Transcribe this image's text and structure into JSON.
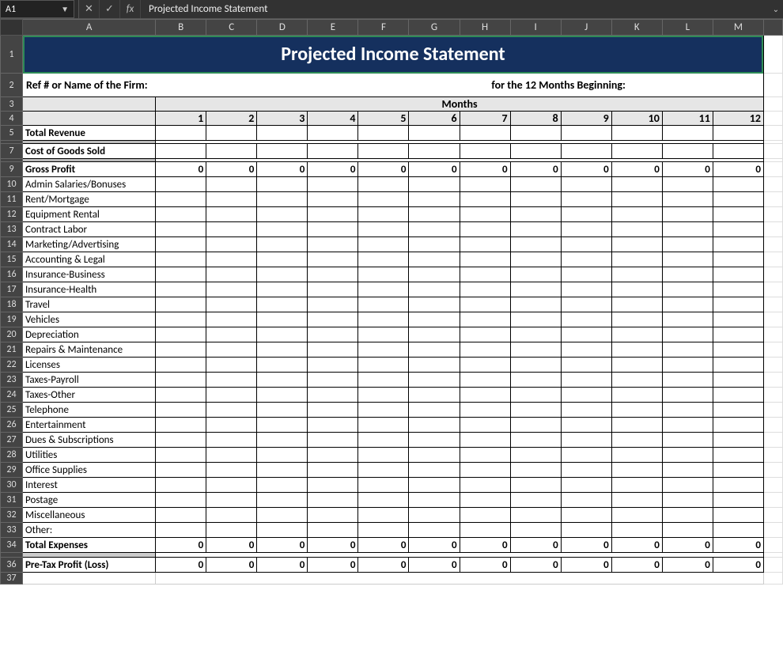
{
  "nameBox": "A1",
  "formulaBar": "Projected Income Statement",
  "columns": [
    "A",
    "B",
    "C",
    "D",
    "E",
    "F",
    "G",
    "H",
    "I",
    "J",
    "K",
    "L",
    "M"
  ],
  "title": "Projected Income Statement",
  "sub": {
    "leftLabel": "Ref # or Name of the Firm:",
    "rightLabel": "for the 12 Months Beginning:"
  },
  "monthsHeader": "Months",
  "monthNumbers": [
    "1",
    "2",
    "3",
    "4",
    "5",
    "6",
    "7",
    "8",
    "9",
    "10",
    "11",
    "12"
  ],
  "rows": {
    "r5": "Total Revenue",
    "r7": "Cost of Goods Sold",
    "r9": "Gross Profit",
    "r10": "Admin Salaries/Bonuses",
    "r11": "Rent/Mortgage",
    "r12": "Equipment Rental",
    "r13": "Contract Labor",
    "r14": "Marketing/Advertising",
    "r15": "Accounting & Legal",
    "r16": "Insurance-Business",
    "r17": "Insurance-Health",
    "r18": "Travel",
    "r19": "Vehicles",
    "r20": "Depreciation",
    "r21": "Repairs & Maintenance",
    "r22": "Licenses",
    "r23": "Taxes-Payroll",
    "r24": "Taxes-Other",
    "r25": "Telephone",
    "r26": "Entertainment",
    "r27": "Dues & Subscriptions",
    "r28": "Utilities",
    "r29": "Office Supplies",
    "r30": "Interest",
    "r31": "Postage",
    "r32": "Miscellaneous",
    "r33": "Other:",
    "r34": "Total Expenses",
    "r36": "Pre-Tax Profit (Loss)"
  },
  "zero": "0"
}
